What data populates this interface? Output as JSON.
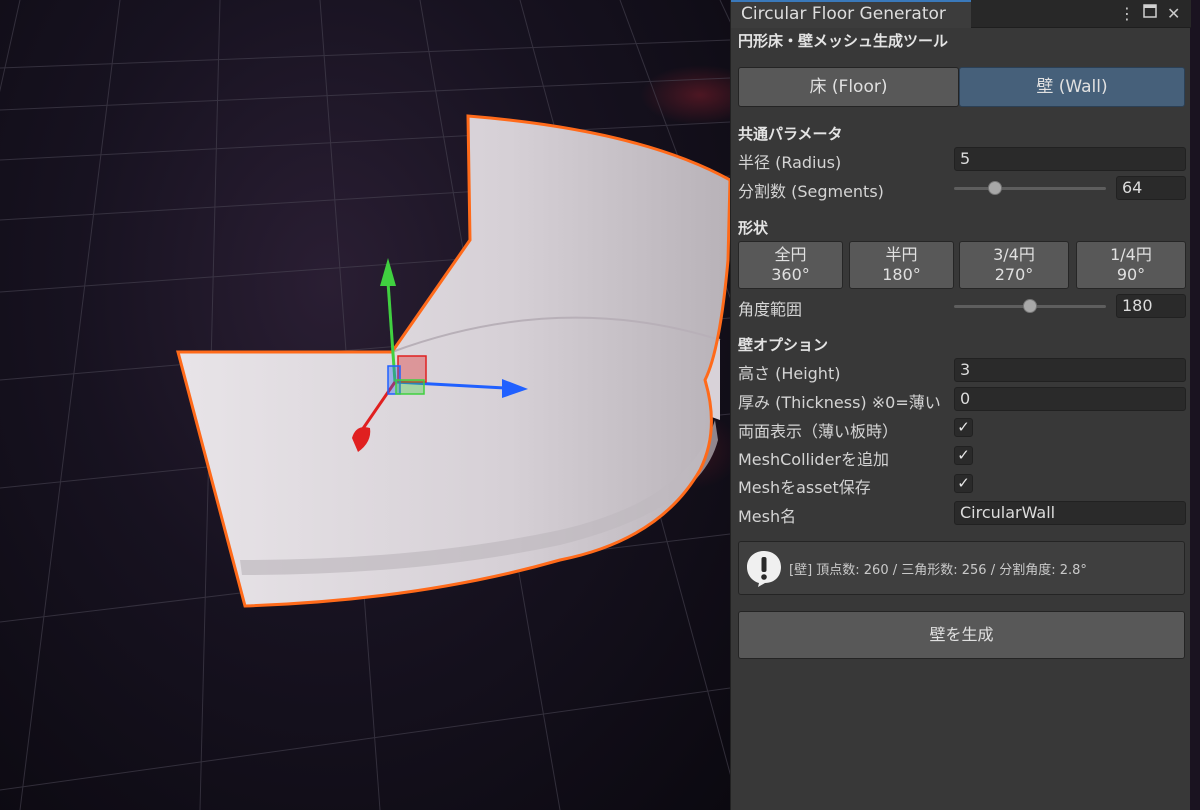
{
  "window": {
    "tab_title": "Circular Floor Generator",
    "subtitle": "円形床・壁メッシュ生成ツール",
    "menu_icon": "kebab-menu-icon",
    "maximize_icon": "maximize-icon",
    "close_icon": "close-icon"
  },
  "mode": {
    "floor_label": "床 (Floor)",
    "wall_label": "壁 (Wall)",
    "selected": "wall"
  },
  "common": {
    "header": "共通パラメータ",
    "radius_label": "半径 (Radius)",
    "radius_value": "5",
    "segments_label": "分割数 (Segments)",
    "segments_value": "64",
    "segments_slider_fraction": 0.27
  },
  "shape": {
    "header": "形状",
    "buttons": [
      {
        "line1": "全円",
        "line2": "360°"
      },
      {
        "line1": "半円",
        "line2": "180°"
      },
      {
        "line1": "3/4円",
        "line2": "270°"
      },
      {
        "line1": "1/4円",
        "line2": "90°"
      }
    ],
    "angle_label": "角度範囲",
    "angle_value": "180",
    "angle_slider_fraction": 0.5
  },
  "wall": {
    "header": "壁オプション",
    "height_label": "高さ (Height)",
    "height_value": "3",
    "thickness_label": "厚み (Thickness) ※0=薄い",
    "thickness_value": "0",
    "double_sided_label": "両面表示（薄い板時）",
    "double_sided_checked": true,
    "collider_label": "MeshColliderを追加",
    "collider_checked": true,
    "save_label": "Meshをasset保存",
    "save_checked": true,
    "mesh_name_label": "Mesh名",
    "mesh_name_value": "CircularWall"
  },
  "info": {
    "icon": "info-exclamation-icon",
    "text": "[壁] 頂点数: 260  /  三角形数: 256  /  分割角度: 2.8°"
  },
  "actions": {
    "generate_label": "壁を生成"
  },
  "colors": {
    "selection_outline": "#ff6a1a",
    "gizmo_x": "#2060ff",
    "gizmo_y": "#40d040",
    "gizmo_z": "#e02020",
    "panel_bg": "#383838",
    "selected_tab": "#46607a"
  }
}
